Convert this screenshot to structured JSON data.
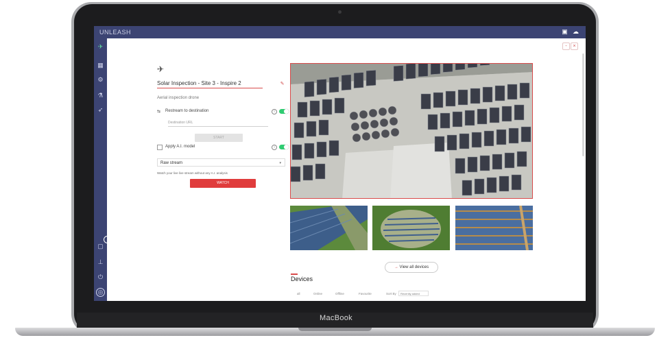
{
  "app": {
    "brand": "UNLEASH",
    "top_icons": [
      "camera-icon",
      "cloud-upload-icon"
    ]
  },
  "sidebar": {
    "items": [
      {
        "icon": "drone-icon",
        "glyph": "✈"
      },
      {
        "icon": "dashboard-icon",
        "glyph": "▦"
      },
      {
        "icon": "settings-icon",
        "glyph": "⚙"
      },
      {
        "icon": "flask-icon",
        "glyph": "⚗"
      },
      {
        "icon": "rocket-icon",
        "glyph": "➶"
      }
    ],
    "bottom_items": [
      {
        "icon": "chat-icon",
        "glyph": "▢"
      },
      {
        "icon": "layout-icon",
        "glyph": "⊥"
      },
      {
        "icon": "power-icon",
        "glyph": "⏻"
      },
      {
        "icon": "user-avatar-icon",
        "glyph": "◎"
      }
    ]
  },
  "mission": {
    "title": "Solar Inspection - Site 3 - Inspire 2",
    "section_label": "Aerial inspection drone",
    "restream_label": "Restream to destination",
    "destination_placeholder": "Destination URL",
    "start_label": "START",
    "apply_ai_label": "Apply A.I. model",
    "stream_select_value": "Raw stream",
    "helper_text": "Watch your live live stream without any A.I. analysis",
    "watch_label": "WATCH"
  },
  "devices": {
    "view_all_label": "View all devices",
    "title": "Devices",
    "tabs": [
      "all",
      "Online",
      "Offline",
      "Favourite"
    ],
    "sort_label": "Sort By",
    "sort_value": "Recently added"
  },
  "device_label": "MacBook",
  "colors": {
    "sidebar": "#3c4473",
    "accent": "#e03c3c",
    "toggle_on": "#2ecc71"
  }
}
